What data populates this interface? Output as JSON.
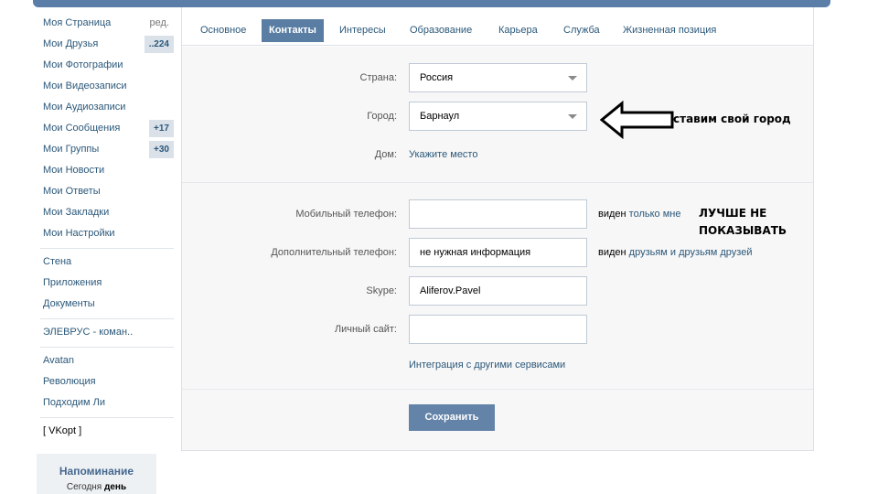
{
  "sidebar": {
    "items": [
      {
        "label": "Моя Страница",
        "extra": "ред."
      },
      {
        "label": "Мои Друзья",
        "badge": "..224"
      },
      {
        "label": "Мои Фотографии"
      },
      {
        "label": "Мои Видеозаписи"
      },
      {
        "label": "Мои Аудиозаписи"
      },
      {
        "label": "Мои Сообщения",
        "badge": "+17"
      },
      {
        "label": "Мои Группы",
        "badge": "+30"
      },
      {
        "label": "Мои Новости"
      },
      {
        "label": "Мои Ответы"
      },
      {
        "label": "Мои Закладки"
      },
      {
        "label": "Мои Настройки"
      }
    ],
    "items2": [
      "Стена",
      "Приложения",
      "Документы"
    ],
    "items3": [
      "ЭЛЕВРУС - коман.."
    ],
    "items4": [
      "Avatan",
      "Революция",
      "Подходим Ли"
    ],
    "items5": [
      "[ VKopt ]"
    ],
    "reminder": {
      "title": "Напоминание",
      "prefix": "Сегодня ",
      "bold": "день"
    }
  },
  "tabs": [
    "Основное",
    "Контакты",
    "Интересы",
    "Образование",
    "Карьера",
    "Служба",
    "Жизненная позиция"
  ],
  "active_tab": "Контакты",
  "form": {
    "country_label": "Страна:",
    "country_value": "Россия",
    "city_label": "Город:",
    "city_value": "Барнаул",
    "home_label": "Дом:",
    "home_link": "Укажите место",
    "mobile_label": "Мобильный телефон:",
    "mobile_value": "",
    "mobile_vis_prefix": "виден ",
    "mobile_vis_link": "только мне",
    "extra_phone_label": "Дополнительный телефон:",
    "extra_phone_value": "не нужная информация",
    "extra_vis_prefix": "виден ",
    "extra_vis_link": "друзьям и друзьям друзей",
    "skype_label": "Skype:",
    "skype_value": "Aliferov.Pavel",
    "site_label": "Личный сайт:",
    "site_value": "",
    "integration_link": "Интеграция с другими сервисами",
    "save_label": "Сохранить"
  },
  "annotations": {
    "city_note": "ставим свой город",
    "phone_note_line1": "ЛУЧШЕ НЕ",
    "phone_note_line2": "ПОКАЗЫВАТЬ"
  },
  "colors": {
    "accent": "#597da3",
    "link": "#2b587a",
    "badge_bg": "#dae1e8"
  }
}
